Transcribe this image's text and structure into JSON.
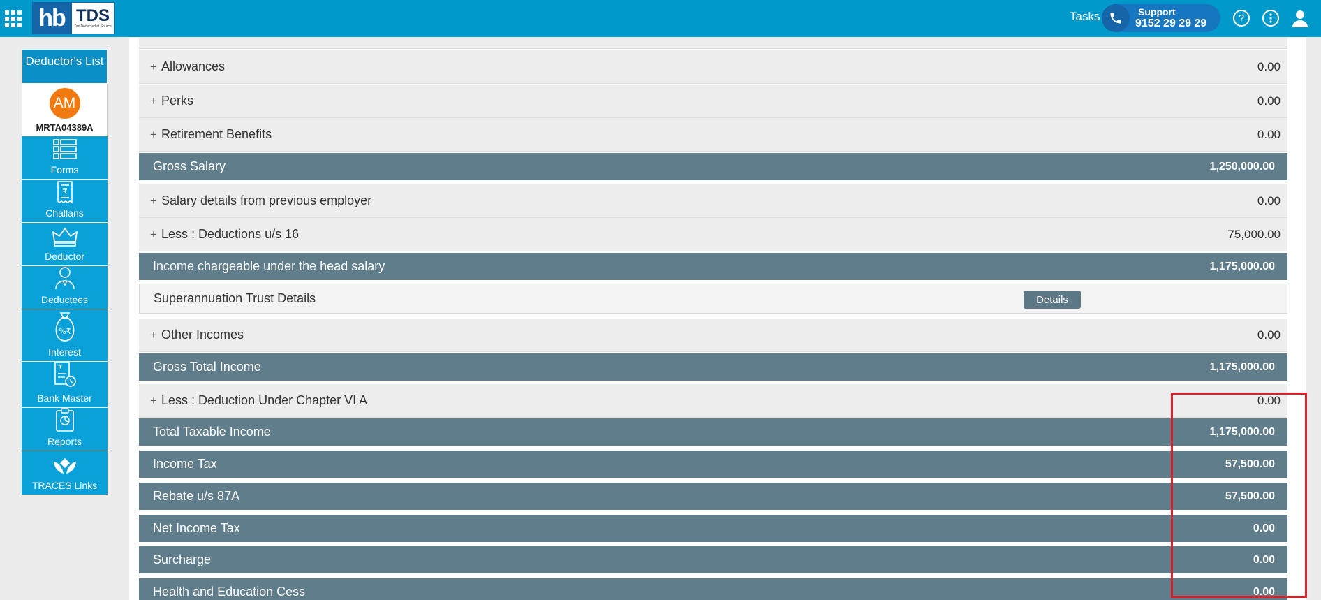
{
  "header": {
    "logo_hb": "hb",
    "logo_tds": "TDS",
    "logo_tagline": "Tax Deducted at Source",
    "tasks_label": "Tasks",
    "support_label": "Support",
    "support_number": "9152 29 29 29",
    "icons": [
      "apps-grid-icon",
      "phone-icon",
      "help-icon",
      "more-vertical-icon",
      "user-icon"
    ]
  },
  "sidebar": {
    "title": "Deductor's List",
    "avatar_initials": "AM",
    "deductor_code": "MRTA04389A",
    "items": [
      {
        "label": "Forms",
        "icon": "forms-icon"
      },
      {
        "label": "Challans",
        "icon": "challan-receipt-icon"
      },
      {
        "label": "Deductor",
        "icon": "crown-icon"
      },
      {
        "label": "Deductees",
        "icon": "person-icon"
      },
      {
        "label": "Interest",
        "icon": "money-bag-icon"
      },
      {
        "label": "Bank Master",
        "icon": "bank-document-icon"
      },
      {
        "label": "Reports",
        "icon": "report-clipboard-icon"
      },
      {
        "label": "TRACES Links",
        "icon": "traces-logo-icon"
      }
    ],
    "accent": "#0aa0d8"
  },
  "rows": [
    {
      "label": "Allowances",
      "value": "0.00",
      "expandable": true,
      "style": "light"
    },
    {
      "label": "Perks",
      "value": "0.00",
      "expandable": true,
      "style": "light"
    },
    {
      "label": "Retirement Benefits",
      "value": "0.00",
      "expandable": true,
      "style": "light"
    },
    {
      "label": "Gross Salary",
      "value": "1,250,000.00",
      "expandable": false,
      "style": "dark"
    },
    {
      "label": "Salary details from previous employer",
      "value": "0.00",
      "expandable": true,
      "style": "light"
    },
    {
      "label": "Less : Deductions u/s 16",
      "value": "75,000.00",
      "expandable": true,
      "style": "light"
    },
    {
      "label": "Income chargeable under the head salary",
      "value": "1,175,000.00",
      "expandable": false,
      "style": "dark"
    },
    {
      "label": "Superannuation Trust Details",
      "value": "",
      "button": "Details",
      "expandable": false,
      "style": "light"
    },
    {
      "label": "Other Incomes",
      "value": "0.00",
      "expandable": true,
      "style": "light"
    },
    {
      "label": "Gross Total Income",
      "value": "1,175,000.00",
      "expandable": false,
      "style": "dark"
    },
    {
      "label": "Less : Deduction Under Chapter VI A",
      "value": "0.00",
      "expandable": true,
      "style": "light"
    },
    {
      "label": "Total Taxable Income",
      "value": "1,175,000.00",
      "expandable": false,
      "style": "dark"
    },
    {
      "label": "Income Tax",
      "value": "57,500.00",
      "expandable": false,
      "style": "dark"
    },
    {
      "label": "Rebate u/s 87A",
      "value": "57,500.00",
      "expandable": false,
      "style": "dark"
    },
    {
      "label": "Net Income Tax",
      "value": "0.00",
      "expandable": false,
      "style": "dark"
    },
    {
      "label": "Surcharge",
      "value": "0.00",
      "expandable": false,
      "style": "dark"
    },
    {
      "label": "Health and Education Cess",
      "value": "0.00",
      "expandable": false,
      "style": "dark"
    }
  ],
  "colors": {
    "topbar": "#0099cc",
    "summary_row": "#607d8b",
    "highlight_box": "#d8232a",
    "avatar": "#f07a10"
  }
}
